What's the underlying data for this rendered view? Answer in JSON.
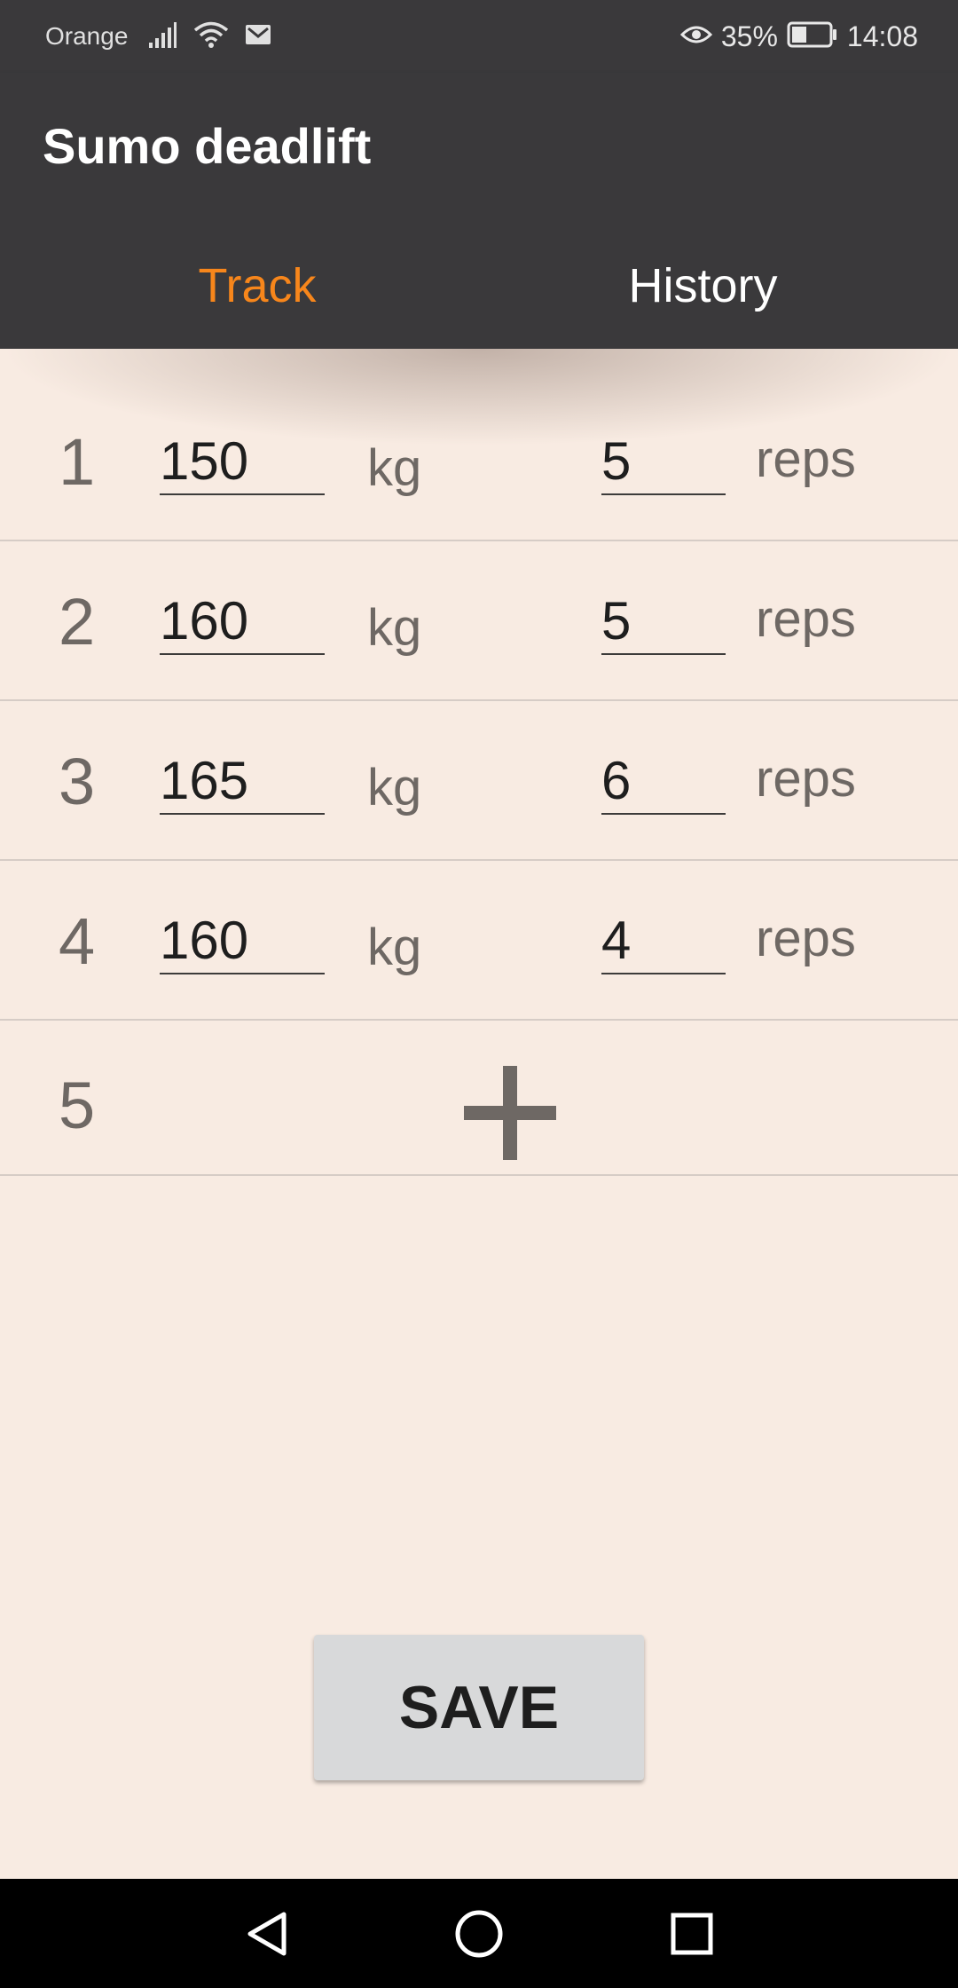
{
  "status_bar": {
    "carrier": "Orange",
    "battery_percent": "35%",
    "time": "14:08",
    "icons": [
      "signal-icon",
      "wifi-icon",
      "mail-icon",
      "eye-icon",
      "battery-icon"
    ]
  },
  "app_bar": {
    "title": "Sumo deadlift"
  },
  "tabs": [
    {
      "label": "Track",
      "active": true,
      "color": "#f7861b"
    },
    {
      "label": "History",
      "active": false,
      "color": "#ffffff"
    }
  ],
  "sets": [
    {
      "number": "1",
      "weight": "150",
      "weight_unit": "kg",
      "reps": "5",
      "reps_unit": "reps"
    },
    {
      "number": "2",
      "weight": "160",
      "weight_unit": "kg",
      "reps": "5",
      "reps_unit": "reps"
    },
    {
      "number": "3",
      "weight": "165",
      "weight_unit": "kg",
      "reps": "6",
      "reps_unit": "reps"
    },
    {
      "number": "4",
      "weight": "160",
      "weight_unit": "kg",
      "reps": "4",
      "reps_unit": "reps"
    }
  ],
  "add_set": {
    "number": "5",
    "icon": "plus-icon"
  },
  "save_label": "SAVE",
  "nav_bar": {
    "icons": [
      "back-icon",
      "home-icon",
      "recents-icon"
    ]
  },
  "colors": {
    "bar_background": "#3a393b",
    "accent": "#f7861b",
    "content_background": "#f8ebe2"
  }
}
